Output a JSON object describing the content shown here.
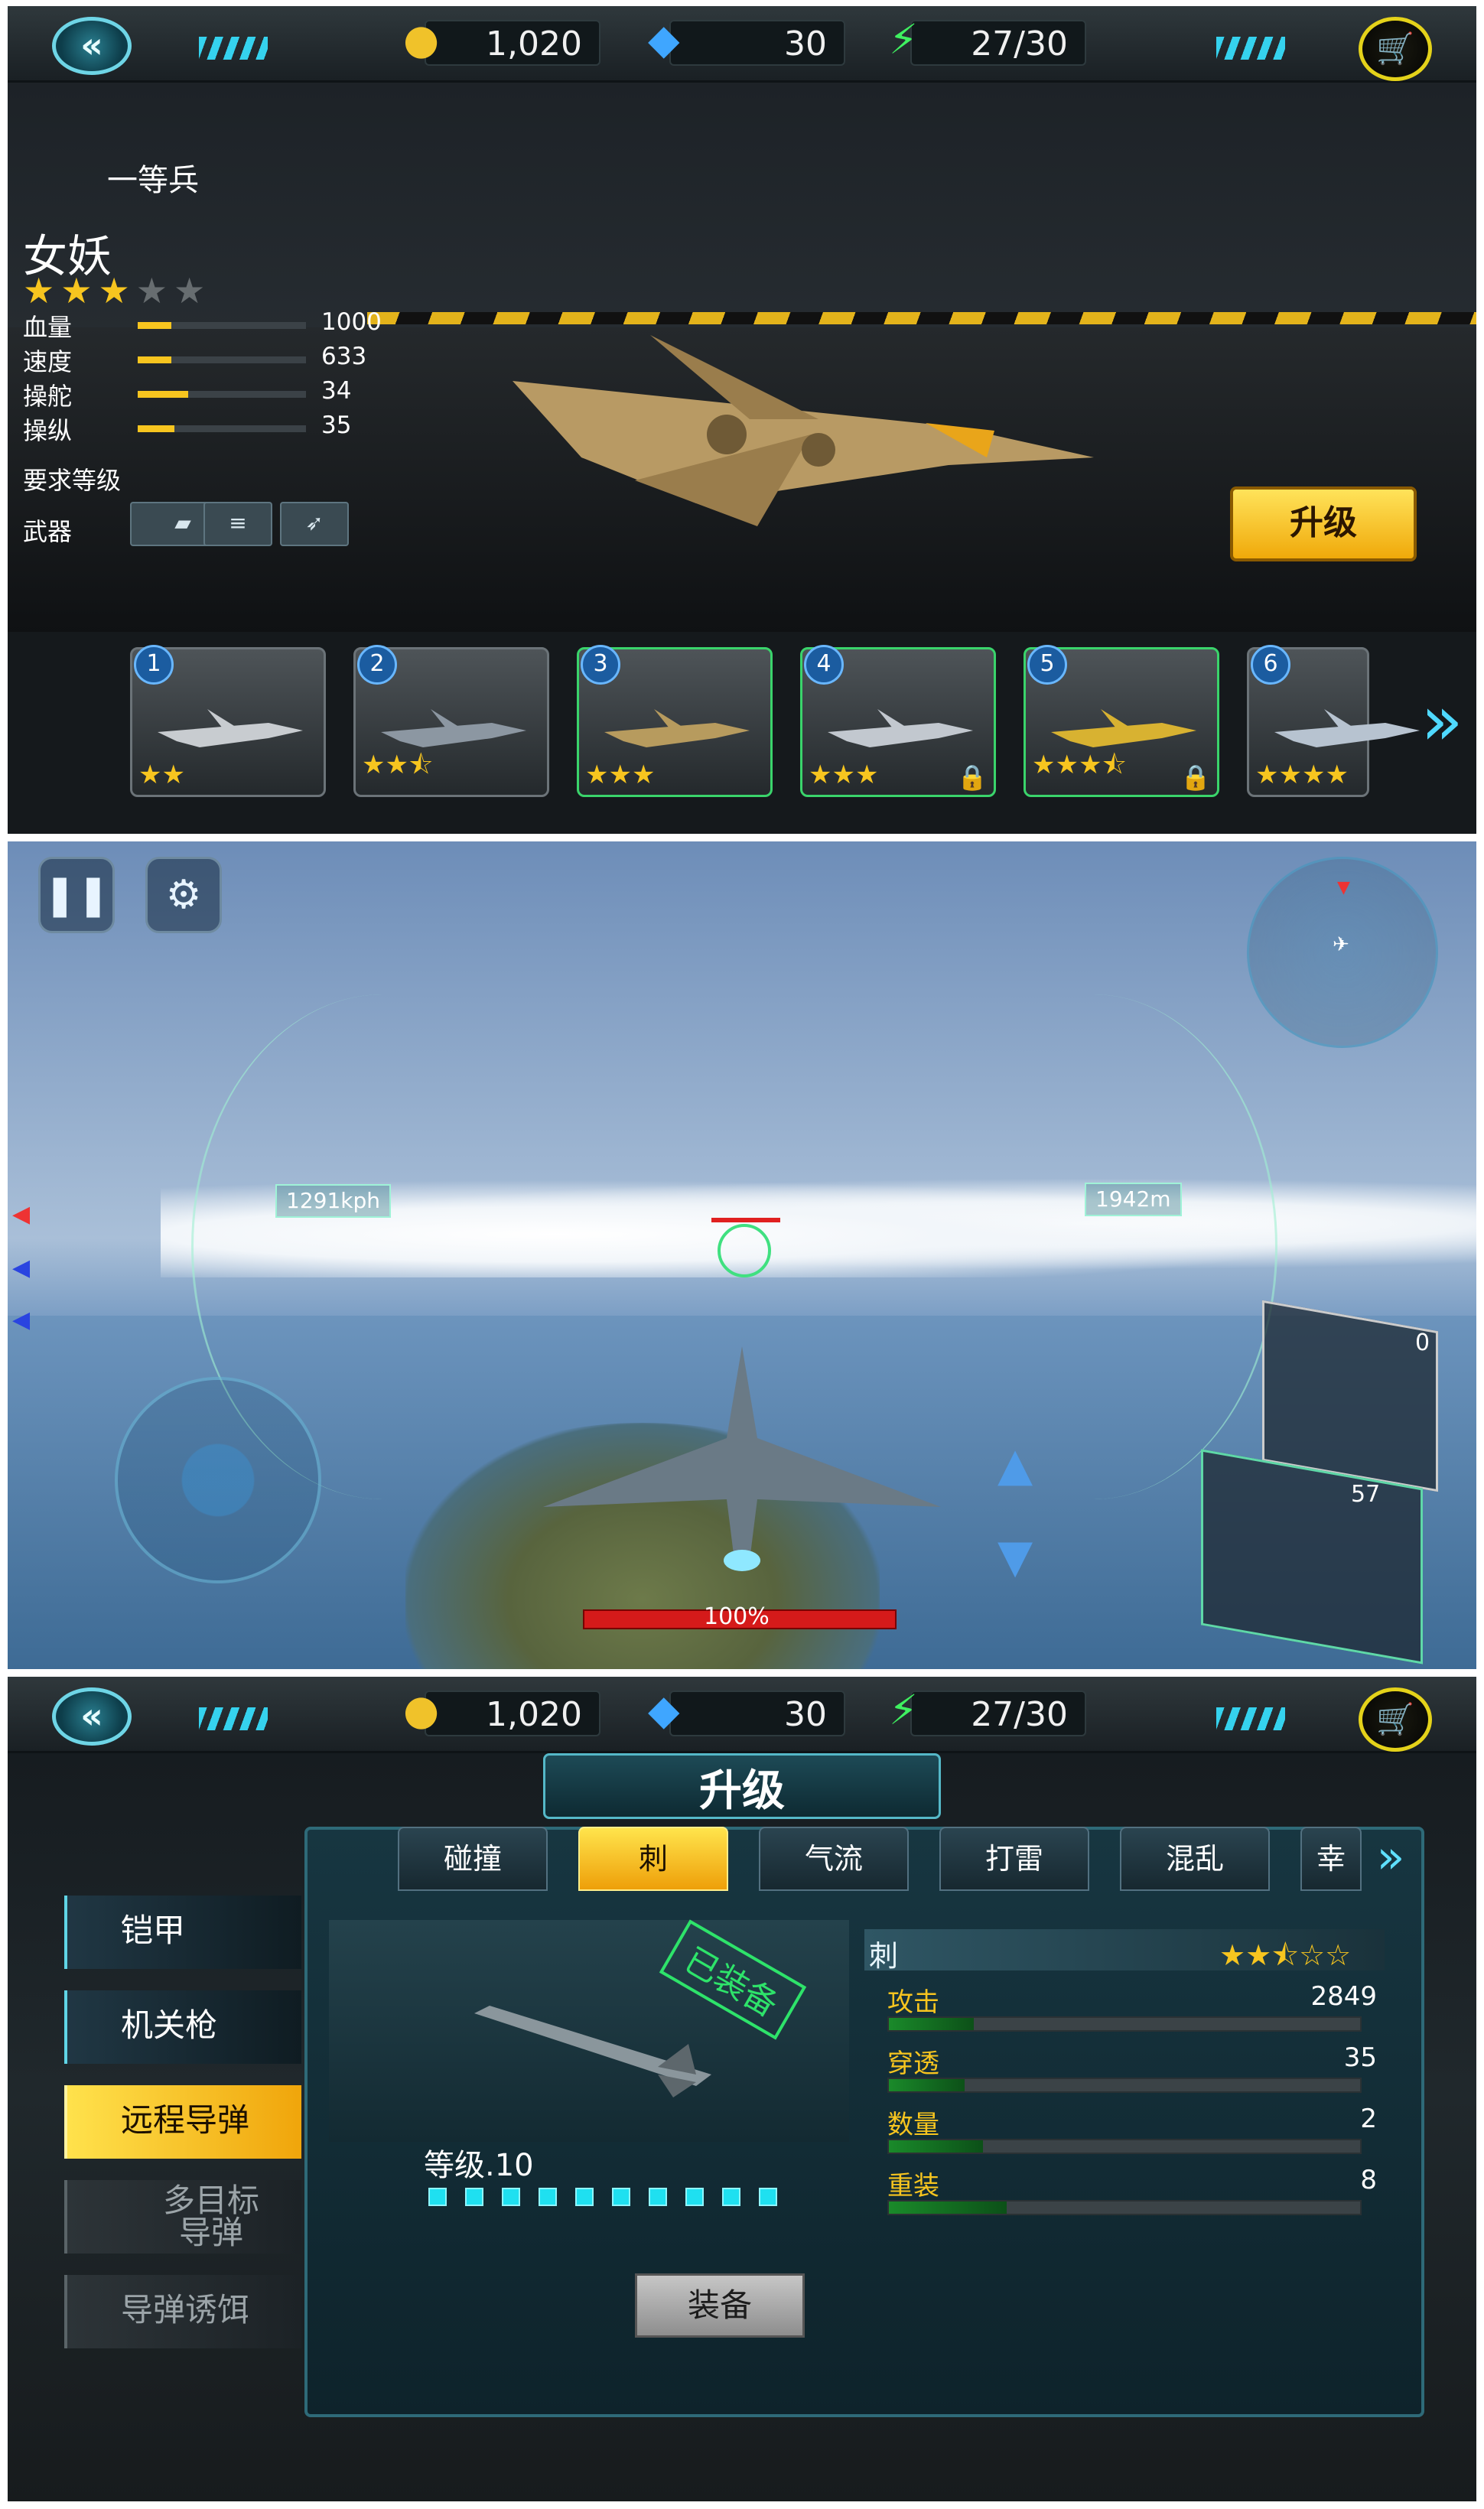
{
  "hangar": {
    "resources": {
      "coins": "1,020",
      "gems": "30",
      "energy": "27/30"
    },
    "rank": "一等兵",
    "plane_name": "女妖",
    "rating": {
      "stars_on": 3,
      "stars_total": 5
    },
    "stats": [
      {
        "label": "血量",
        "value": "1000",
        "fraction": 0.2
      },
      {
        "label": "速度",
        "value": "633",
        "fraction": 0.2
      },
      {
        "label": "操舵",
        "value": "34",
        "fraction": 0.3
      },
      {
        "label": "操纵",
        "value": "35",
        "fraction": 0.22
      }
    ],
    "required_level_label": "要求等级",
    "weapons_label": "武器",
    "upgrade_label": "升级",
    "aircraft": [
      {
        "number": "1",
        "stars": "★★",
        "locked": false
      },
      {
        "number": "2",
        "stars": "★★⯪",
        "locked": false
      },
      {
        "number": "3",
        "stars": "★★★",
        "locked": false
      },
      {
        "number": "4",
        "stars": "★★★",
        "locked": true
      },
      {
        "number": "5",
        "stars": "★★★⯪",
        "locked": true
      },
      {
        "number": "6",
        "stars": "★★★★",
        "locked": false
      }
    ]
  },
  "flight": {
    "speed": "1291kph",
    "altitude": "1942m",
    "health": "100%",
    "missile_count": "0",
    "bullet_count": "57"
  },
  "upgrade_screen": {
    "resources": {
      "coins": "1,020",
      "gems": "30",
      "energy": "27/30"
    },
    "title": "升级",
    "tabs": [
      "碰撞",
      "刺",
      "气流",
      "打雷",
      "混乱",
      "幸"
    ],
    "active_tab": 1,
    "categories": [
      "铠甲",
      "机关枪",
      "远程导弹",
      "多目标\n导弹",
      "导弹诱饵"
    ],
    "active_category": 2,
    "equipped_stamp": "已装备",
    "level": "等级.10",
    "level_pips": 10,
    "equip_label": "装备",
    "weapon_name": "刺",
    "weapon_stars": "★★⯪☆☆",
    "stats": [
      {
        "label": "攻击",
        "value": "2849",
        "fraction": 0.18
      },
      {
        "label": "穿透",
        "value": "35",
        "fraction": 0.16
      },
      {
        "label": "数量",
        "value": "2",
        "fraction": 0.2
      },
      {
        "label": "重装",
        "value": "8",
        "fraction": 0.25
      }
    ]
  }
}
